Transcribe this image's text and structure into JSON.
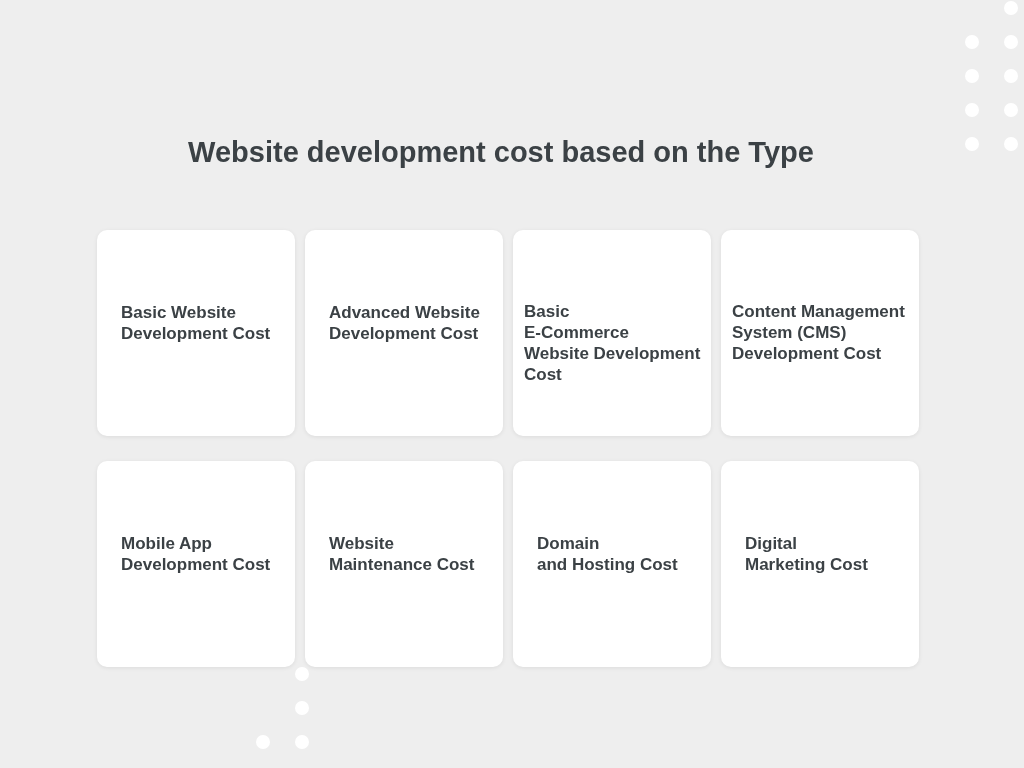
{
  "title": "Website development cost based on the Type",
  "cards": [
    {
      "label": "Basic Website\nDevelopment Cost"
    },
    {
      "label": "Advanced Website\nDevelopment Cost"
    },
    {
      "label": "Basic\nE-Commerce\nWebsite Development\nCost"
    },
    {
      "label": "Content Management\nSystem (CMS)\nDevelopment Cost"
    },
    {
      "label": "Mobile App\nDevelopment Cost"
    },
    {
      "label": "Website\nMaintenance Cost"
    },
    {
      "label": "Domain\nand Hosting Cost"
    },
    {
      "label": "Digital\nMarketing Cost"
    }
  ]
}
